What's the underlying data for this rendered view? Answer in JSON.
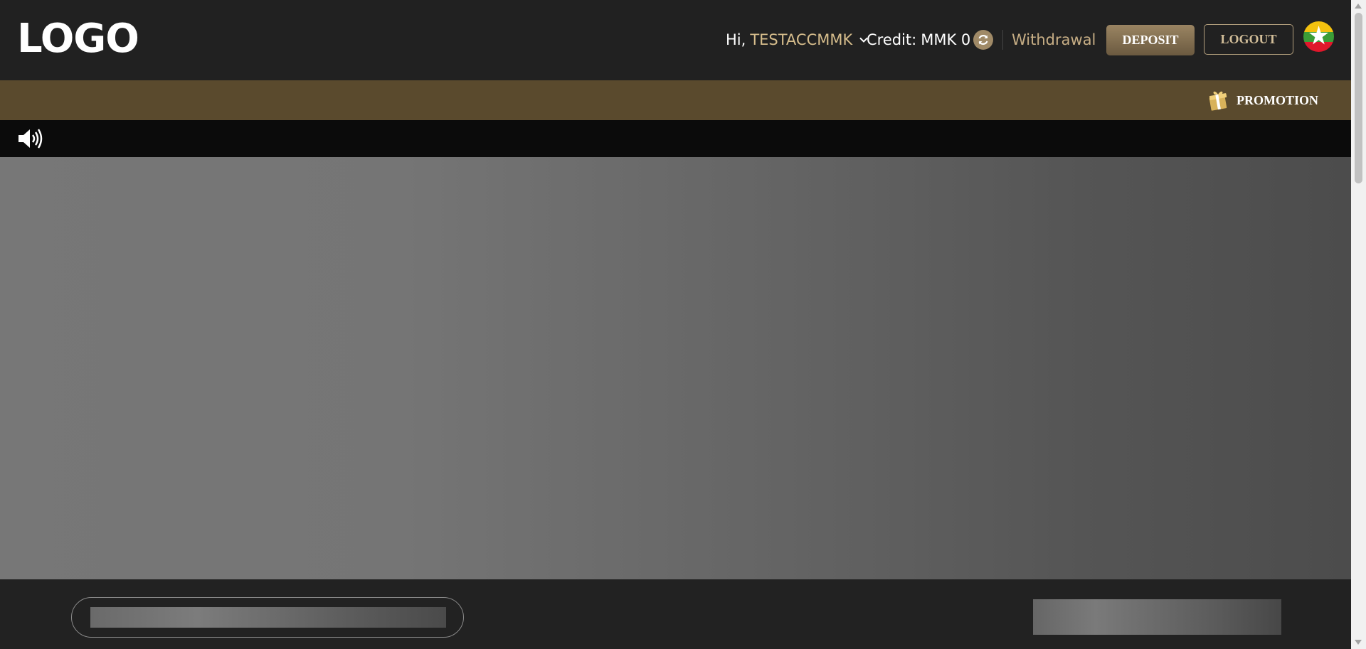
{
  "header": {
    "logo": "LOGO",
    "greeting": "Hi,",
    "username": "TESTACCMMK",
    "credit_label": "Credit:",
    "credit_value": "MMK 0",
    "withdrawal_label": "Withdrawal",
    "deposit_label": "DEPOSIT",
    "logout_label": "LOGOUT",
    "language_flag": "myanmar-flag-icon"
  },
  "promo_bar": {
    "promotion_label": "PROMOTION",
    "icon": "gift-icon"
  },
  "marquee": {
    "icon": "speaker-icon"
  },
  "colors": {
    "header_bg": "#212121",
    "promo_bar_bg": "#5a4a2d",
    "accent_gold": "#d6bd8c",
    "marquee_bg": "#0b0b0b"
  }
}
